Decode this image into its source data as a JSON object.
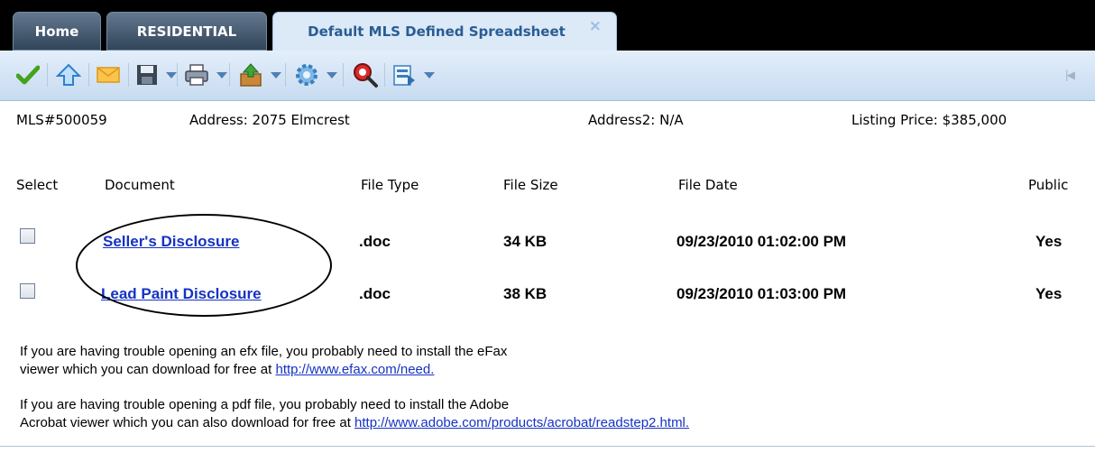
{
  "tabs": [
    {
      "label": "Home"
    },
    {
      "label": "RESIDENTIAL"
    },
    {
      "label": "Default MLS Defined Spreadsheet",
      "close_icon": "×"
    }
  ],
  "toolbar": {
    "buttons": [
      {
        "icon": "checkmark-icon"
      },
      {
        "icon": "home-arrow-icon"
      },
      {
        "icon": "envelope-icon"
      },
      {
        "icon": "save-icon",
        "dropdown": true
      },
      {
        "icon": "print-icon",
        "dropdown": true
      },
      {
        "icon": "export-icon",
        "dropdown": true
      },
      {
        "icon": "gear-icon",
        "dropdown": true
      },
      {
        "icon": "magnifier-icon"
      },
      {
        "icon": "report-icon",
        "dropdown": true
      }
    ],
    "end_glyph": "|◀"
  },
  "listing": {
    "mls": "MLS#500059",
    "address": "Address: 2075 Elmcrest",
    "address2": "Address2: N/A",
    "price": "Listing Price: $385,000"
  },
  "columns": {
    "select": "Select",
    "document": "Document",
    "file_type": "File Type",
    "file_size": "File Size",
    "file_date": "File Date",
    "public": "Public"
  },
  "rows": [
    {
      "document": "Seller's Disclosure",
      "file_type": ".doc",
      "file_size": "34 KB",
      "file_date": "09/23/2010 01:02:00 PM",
      "public": "Yes"
    },
    {
      "document": "Lead Paint Disclosure",
      "file_type": ".doc",
      "file_size": "38 KB",
      "file_date": "09/23/2010 01:03:00 PM",
      "public": "Yes"
    }
  ],
  "notes": {
    "efax_line1": "If you are having trouble opening an efx file, you probably need to install the eFax",
    "efax_line2": "viewer which you can download for free at ",
    "efax_url": "http://www.efax.com/need.",
    "pdf_line1": "If you are having trouble opening a pdf file, you probably need to install the Adobe",
    "pdf_line2": "Acrobat viewer which you can also download for free at ",
    "pdf_url": "http://www.adobe.com/products/acrobat/readstep2.html."
  }
}
